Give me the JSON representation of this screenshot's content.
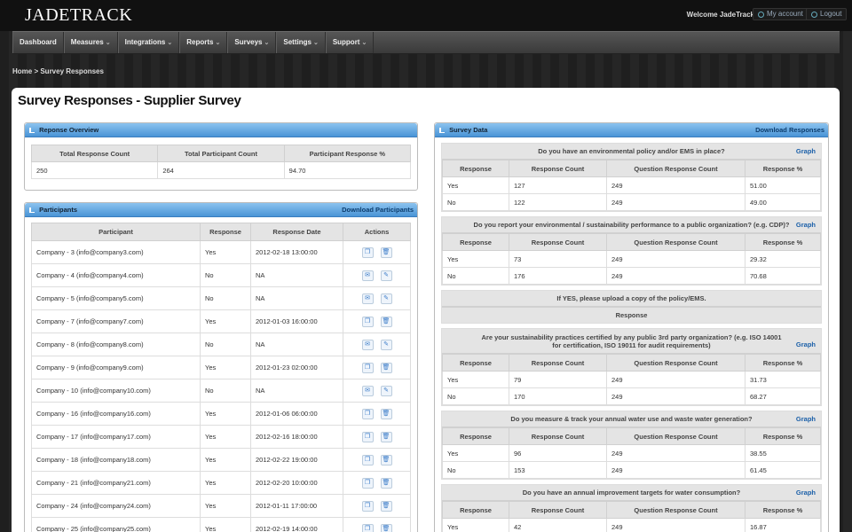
{
  "header": {
    "logo": "JADETRACK",
    "welcome": "Welcome JadeTrack",
    "my_account": "My account",
    "logout": "Logout"
  },
  "nav": [
    {
      "label": "Dashboard",
      "caret": false
    },
    {
      "label": "Measures",
      "caret": true
    },
    {
      "label": "Integrations",
      "caret": true
    },
    {
      "label": "Reports",
      "caret": true
    },
    {
      "label": "Surveys",
      "caret": true
    },
    {
      "label": "Settings",
      "caret": true
    },
    {
      "label": "Support",
      "caret": true
    }
  ],
  "breadcrumb": "Home > Survey Responses",
  "page_title": "Survey Responses - Supplier Survey",
  "overview": {
    "title": "Reponse Overview",
    "headers": [
      "Total Response Count",
      "Total Participant Count",
      "Participant Response %"
    ],
    "values": [
      "250",
      "264",
      "94.70"
    ]
  },
  "participants": {
    "title": "Participants",
    "download": "Download Participants",
    "headers": [
      "Participant",
      "Response",
      "Response Date",
      "Actions"
    ],
    "rows": [
      {
        "name": "Company - 3 (info@company3.com)",
        "response": "Yes",
        "date": "2012-02-18 13:00:00",
        "icons": [
          "copy-icon",
          "trash-icon"
        ]
      },
      {
        "name": "Company - 4 (info@company4.com)",
        "response": "No",
        "date": "NA",
        "icons": [
          "email-icon",
          "edit-icon"
        ]
      },
      {
        "name": "Company - 5 (info@company5.com)",
        "response": "No",
        "date": "NA",
        "icons": [
          "email-icon",
          "edit-icon"
        ]
      },
      {
        "name": "Company - 7 (info@company7.com)",
        "response": "Yes",
        "date": "2012-01-03 16:00:00",
        "icons": [
          "copy-icon",
          "trash-icon"
        ]
      },
      {
        "name": "Company - 8 (info@company8.com)",
        "response": "No",
        "date": "NA",
        "icons": [
          "email-icon",
          "edit-icon"
        ]
      },
      {
        "name": "Company - 9 (info@company9.com)",
        "response": "Yes",
        "date": "2012-01-23 02:00:00",
        "icons": [
          "copy-icon",
          "trash-icon"
        ]
      },
      {
        "name": "Company - 10 (info@company10.com)",
        "response": "No",
        "date": "NA",
        "icons": [
          "email-icon",
          "edit-icon"
        ]
      },
      {
        "name": "Company - 16 (info@company16.com)",
        "response": "Yes",
        "date": "2012-01-06 06:00:00",
        "icons": [
          "copy-icon",
          "trash-icon"
        ]
      },
      {
        "name": "Company - 17 (info@company17.com)",
        "response": "Yes",
        "date": "2012-02-16 18:00:00",
        "icons": [
          "copy-icon",
          "trash-icon"
        ]
      },
      {
        "name": "Company - 18 (info@company18.com)",
        "response": "Yes",
        "date": "2012-02-22 19:00:00",
        "icons": [
          "copy-icon",
          "trash-icon"
        ]
      },
      {
        "name": "Company - 21 (info@company21.com)",
        "response": "Yes",
        "date": "2012-02-20 10:00:00",
        "icons": [
          "copy-icon",
          "trash-icon"
        ]
      },
      {
        "name": "Company - 24 (info@company24.com)",
        "response": "Yes",
        "date": "2012-01-11 17:00:00",
        "icons": [
          "copy-icon",
          "trash-icon"
        ]
      },
      {
        "name": "Company - 25 (info@company25.com)",
        "response": "Yes",
        "date": "2012-02-19 14:00:00",
        "icons": [
          "copy-icon",
          "trash-icon"
        ]
      }
    ]
  },
  "survey": {
    "title": "Survey Data",
    "download": "Download Responses",
    "graph_label": "Graph",
    "headers": [
      "Response",
      "Response Count",
      "Question Response Count",
      "Response %"
    ],
    "questions": [
      {
        "question": "Do you have an environmental policy and/or EMS in place?",
        "graph": true,
        "tall": false,
        "rows": [
          [
            "Yes",
            "127",
            "249",
            "51.00"
          ],
          [
            "No",
            "122",
            "249",
            "49.00"
          ]
        ]
      },
      {
        "question": "Do you report your environmental / sustainability performance to a public organization? (e.g. CDP)?",
        "graph": true,
        "tall": false,
        "rows": [
          [
            "Yes",
            "73",
            "249",
            "29.32"
          ],
          [
            "No",
            "176",
            "249",
            "70.68"
          ]
        ]
      },
      {
        "question": "If YES, please upload a copy of the policy/EMS.",
        "graph": false,
        "tall": false,
        "sub": "Response",
        "rows": []
      },
      {
        "question": "Are your sustainability practices certified by any public 3rd party organization? (e.g. ISO 14001 for certification, ISO 19011 for audit requirements)",
        "graph": true,
        "tall": true,
        "rows": [
          [
            "Yes",
            "79",
            "249",
            "31.73"
          ],
          [
            "No",
            "170",
            "249",
            "68.27"
          ]
        ]
      },
      {
        "question": "Do you measure & track your annual water use and waste water generation?",
        "graph": true,
        "tall": false,
        "rows": [
          [
            "Yes",
            "96",
            "249",
            "38.55"
          ],
          [
            "No",
            "153",
            "249",
            "61.45"
          ]
        ]
      },
      {
        "question": "Do you have an annual improvement targets for water consumption?",
        "graph": true,
        "tall": false,
        "rows": [
          [
            "Yes",
            "42",
            "249",
            "16.87"
          ]
        ]
      }
    ]
  }
}
